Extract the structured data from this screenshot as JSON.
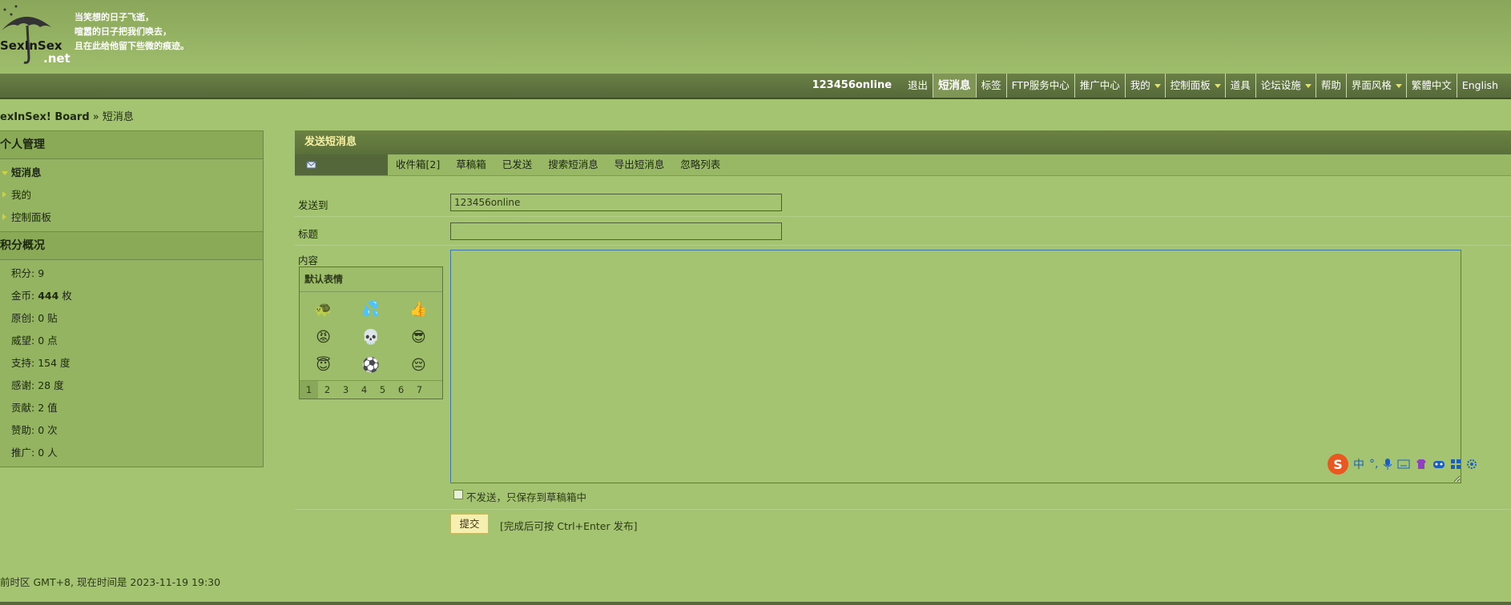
{
  "site": {
    "logo_text": "SexInSex",
    "logo_suffix": ".net",
    "poem": [
      "当笑想的日子飞逝，",
      "喧嚣的日子把我们唤去，",
      "且在此给他留下些微的痕迹。"
    ]
  },
  "nav": {
    "username": "123456online",
    "items": [
      {
        "label": "退出",
        "active": false,
        "dropdown": false
      },
      {
        "label": "短消息",
        "active": true,
        "dropdown": false
      },
      {
        "label": "标签",
        "active": false,
        "dropdown": false
      },
      {
        "label": "FTP服务中心",
        "active": false,
        "dropdown": false
      },
      {
        "label": "推广中心",
        "active": false,
        "dropdown": false
      },
      {
        "label": "我的",
        "active": false,
        "dropdown": true
      },
      {
        "label": "控制面板",
        "active": false,
        "dropdown": true
      },
      {
        "label": "道具",
        "active": false,
        "dropdown": false
      },
      {
        "label": "论坛设施",
        "active": false,
        "dropdown": true
      },
      {
        "label": "帮助",
        "active": false,
        "dropdown": false
      },
      {
        "label": "界面风格",
        "active": false,
        "dropdown": true
      },
      {
        "label": "繁體中文",
        "active": false,
        "dropdown": false
      },
      {
        "label": "English",
        "active": false,
        "dropdown": false
      }
    ]
  },
  "breadcrumb": {
    "board": "exInSex! Board",
    "sep": " » ",
    "current": "短消息"
  },
  "sidebar": {
    "personal": {
      "title": "个人管理",
      "items": [
        "短消息",
        "我的",
        "控制面板"
      ]
    },
    "credits": {
      "title": "积分概况",
      "items": [
        {
          "label": "积分: ",
          "value": "9",
          "unit": ""
        },
        {
          "label": "金币: ",
          "value": "444",
          "unit": " 枚"
        },
        {
          "label": "原创: ",
          "value": "0",
          "unit": " 贴"
        },
        {
          "label": "威望: ",
          "value": "0",
          "unit": " 点"
        },
        {
          "label": "支持: ",
          "value": "154",
          "unit": " 度"
        },
        {
          "label": "感谢: ",
          "value": "28",
          "unit": " 度"
        },
        {
          "label": "贡献: ",
          "value": "2",
          "unit": " 值"
        },
        {
          "label": "赞助: ",
          "value": "0",
          "unit": " 次"
        },
        {
          "label": "推广: ",
          "value": "0",
          "unit": " 人"
        }
      ]
    }
  },
  "main": {
    "title": "发送短消息",
    "tabs": [
      "收件箱[2]",
      "草稿箱",
      "已发送",
      "搜索短消息",
      "导出短消息",
      "忽略列表"
    ],
    "form": {
      "to_label": "发送到",
      "to_value": "123456online",
      "subject_label": "标题",
      "subject_value": "",
      "content_label": "内容",
      "smilies_title": "默认表情",
      "smilies": [
        "🐢",
        "💦",
        "👍",
        "😡",
        "💀",
        "😎",
        "😇",
        "⚽",
        "😔"
      ],
      "smiley_pages": [
        "1",
        "2",
        "3",
        "4",
        "5",
        "6",
        "7"
      ],
      "save_draft_label": "不发送，只保存到草稿箱中",
      "submit_label": "提交",
      "submit_hint": "[完成后可按 Ctrl+Enter 发布]"
    }
  },
  "ime": {
    "logo": "S",
    "mode": "中"
  },
  "footer": {
    "text": "前时区 GMT+8, 现在时间是 2023-11-19 19:30"
  }
}
